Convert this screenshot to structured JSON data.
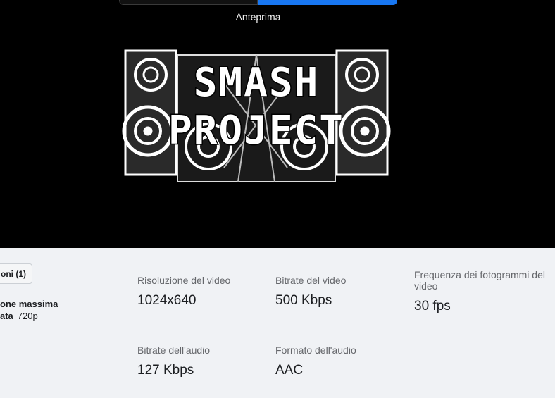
{
  "preview": {
    "label": "Anteprima"
  },
  "toggle": {
    "active_color": "#1877f2"
  },
  "logo": {
    "line1": "SMASH",
    "line2": "PROJECT"
  },
  "info": {
    "options_button": "oni (1)",
    "resolution_title": "one massima",
    "resolution_key": "ata",
    "resolution_value": "720p"
  },
  "stats": [
    {
      "label": "Risoluzione del video",
      "value": "1024x640"
    },
    {
      "label": "Bitrate del video",
      "value": "500 Kbps"
    },
    {
      "label": "Frequenza dei fotogrammi del video",
      "value": "30 fps"
    },
    {
      "label": "Bitrate dell'audio",
      "value": "127 Kbps"
    },
    {
      "label": "Formato dell'audio",
      "value": "AAC"
    }
  ]
}
